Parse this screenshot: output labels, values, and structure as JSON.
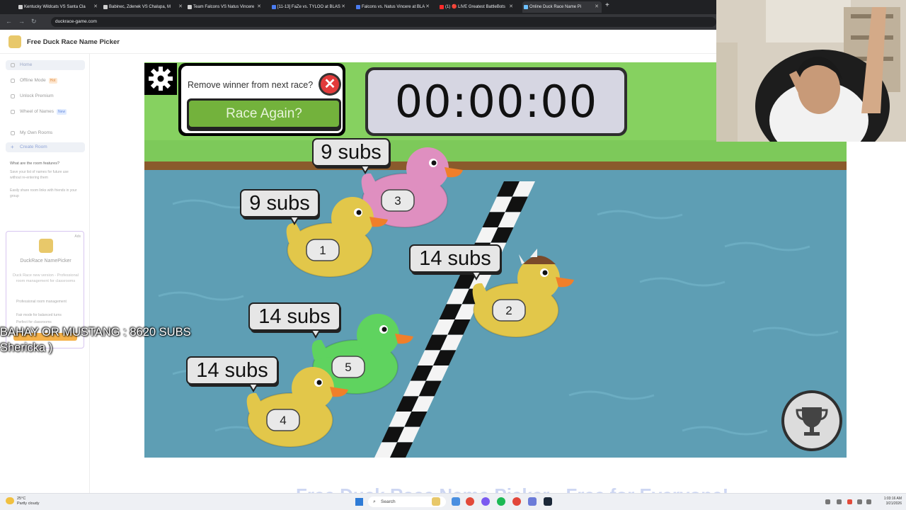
{
  "browser": {
    "tabs": [
      {
        "title": "Kentucky Wildcats VS Santa Cla",
        "color": "#cfcfcf"
      },
      {
        "title": "Babinec, Zdenek VS Chalupa, M",
        "color": "#cfcfcf"
      },
      {
        "title": "Team Falcons VS Natus Vincere",
        "color": "#cfcfcf"
      },
      {
        "title": "[11-13] FaZe vs. TYLOO at BLAS",
        "color": "#4a7cf0"
      },
      {
        "title": "Falcons vs. Natus Vincere at BLA",
        "color": "#4a7cf0"
      },
      {
        "title": "(1) 🔴 LIVE Greatest BattleBots",
        "color": "#ff2a2a"
      },
      {
        "title": "Online Duck Race Name Pi",
        "color": "#6cc0ff"
      }
    ],
    "url": "duckrace-game.com"
  },
  "site": {
    "title": "Free Duck Race Name Picker"
  },
  "sidebar": {
    "items": [
      {
        "label": "Home"
      },
      {
        "label": "Offline Mode",
        "badge": "Hot"
      },
      {
        "label": "Unlock Premium"
      },
      {
        "label": "Wheel of Names",
        "badge": "New"
      },
      {
        "label": "My Own Rooms"
      },
      {
        "label": "Create Room"
      }
    ],
    "question": "What are the room features?",
    "features": [
      "Save your list of names for future use without re-entering them",
      "Easily share room links with friends in your group"
    ],
    "ad": {
      "tag": "Ads",
      "title": "DuckRace NamePicker",
      "desc": "Duck Race new version - Professional room management for classrooms",
      "items": [
        "Professional room management",
        "Fair mode for balanced turns",
        "Perfect for classrooms"
      ]
    }
  },
  "game": {
    "remove_label": "Remove winner from next race?",
    "race_again_label": "Race Again?",
    "timer": "00:00:00",
    "ducks": [
      {
        "number": "3",
        "label": "9 subs",
        "color": "#df8fc0"
      },
      {
        "number": "1",
        "label": "9 subs",
        "color": "#e2c74a"
      },
      {
        "number": "2",
        "label": "14 subs",
        "color": "#e2c74a"
      },
      {
        "number": "5",
        "label": "14 subs",
        "color": "#5fd35f"
      },
      {
        "number": "4",
        "label": "14 subs",
        "color": "#e2c74a"
      }
    ]
  },
  "overlay": {
    "line1": "BAHAY OR MUSTANG : 8620 SUBS",
    "line2": "Shericka )"
  },
  "below": {
    "heading": "Free Duck Race Name Picker - Free for Everyone!"
  },
  "taskbar": {
    "weather_temp": "25°C",
    "weather_desc": "Partly cloudy",
    "search_placeholder": "Search",
    "time": "1:03:16 AM",
    "date": "3/21/2026"
  }
}
